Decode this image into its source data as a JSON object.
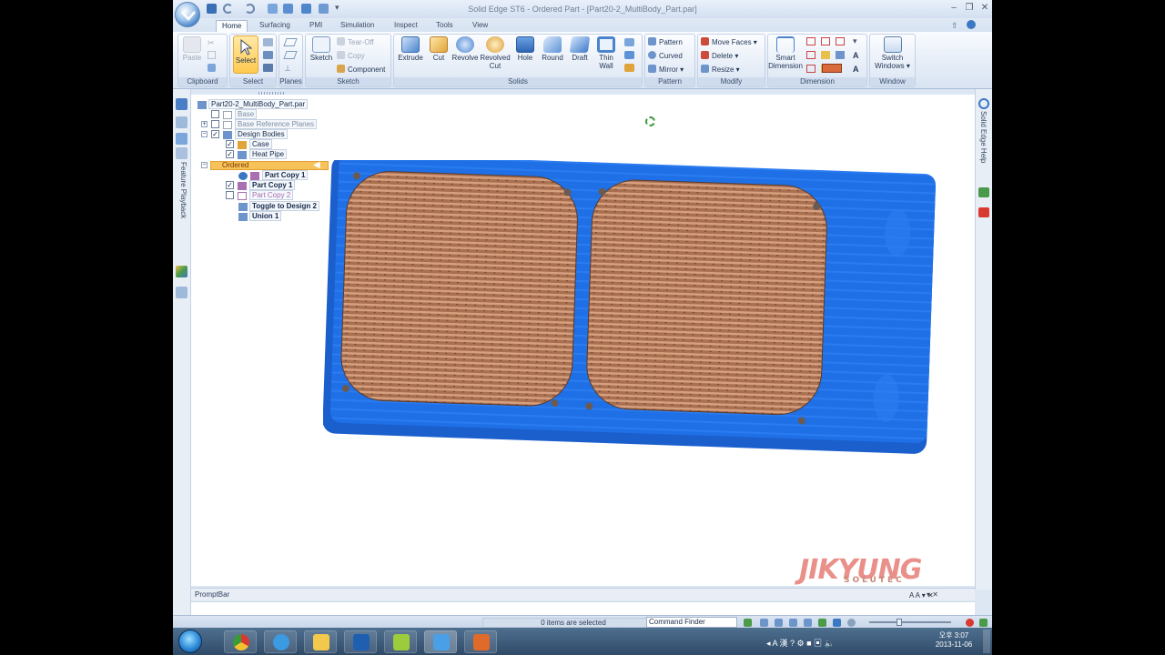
{
  "app": {
    "window_title": "Solid Edge ST6 - Ordered Part - [Part20-2_MultiBody_Part.par]",
    "tabs": [
      "Home",
      "Surfacing",
      "PMI",
      "Simulation",
      "Inspect",
      "Tools",
      "View"
    ],
    "active_tab": "Home"
  },
  "ribbon": {
    "clipboard": {
      "label": "Clipboard",
      "paste": "Paste"
    },
    "select": {
      "label": "Select",
      "select": "Select"
    },
    "planes": {
      "label": "Planes"
    },
    "sketch": {
      "label": "Sketch",
      "sketch": "Sketch",
      "tear_off": "Tear-Off",
      "copy": "Copy",
      "component": "Component"
    },
    "solids": {
      "label": "Solids",
      "extrude": "Extrude",
      "cut": "Cut",
      "revolve": "Revolve",
      "revolved_cut_1": "Revolved",
      "revolved_cut_2": "Cut",
      "hole": "Hole",
      "round": "Round",
      "draft": "Draft",
      "thin_wall_1": "Thin",
      "thin_wall_2": "Wall"
    },
    "pattern": {
      "label": "Pattern",
      "pattern": "Pattern",
      "curved": "Curved",
      "mirror": "Mirror"
    },
    "modify": {
      "label": "Modify",
      "move_faces": "Move Faces",
      "delete": "Delete",
      "resize": "Resize"
    },
    "dimension": {
      "label": "Dimension",
      "smart_1": "Smart",
      "smart_2": "Dimension"
    },
    "window": {
      "label": "Window",
      "switch_1": "Switch",
      "switch_2": "Windows"
    }
  },
  "tree": {
    "root": "Part20-2_MultiBody_Part.par",
    "base": "Base",
    "base_ref": "Base Reference Planes",
    "design_bodies": "Design Bodies",
    "case": "Case",
    "heat_pipe": "Heat Pipe",
    "ordered": "Ordered",
    "part_copy_1a": "Part Copy 1",
    "part_copy_1b": "Part Copy 1",
    "part_copy_2": "Part Copy 2",
    "toggle": "Toggle to Design 2",
    "union": "Union 1"
  },
  "left_panel": {
    "feature_playback": "Feature Playback"
  },
  "right_panel": {
    "help": "Solid Edge Help"
  },
  "promptbar": {
    "title": "PromptBar"
  },
  "status": {
    "selection": "0 items are selected",
    "command_finder": "Command Finder"
  },
  "taskbar": {
    "time": "오후 3:07",
    "date": "2013-11-06"
  },
  "watermark": {
    "brand": "JIKYUNG",
    "sub": "SOLUTEC"
  },
  "colors": {
    "part_blue": "#1f6fe6",
    "fin_copper": "#b87a5a",
    "ordered_bar": "#f7c25a"
  }
}
